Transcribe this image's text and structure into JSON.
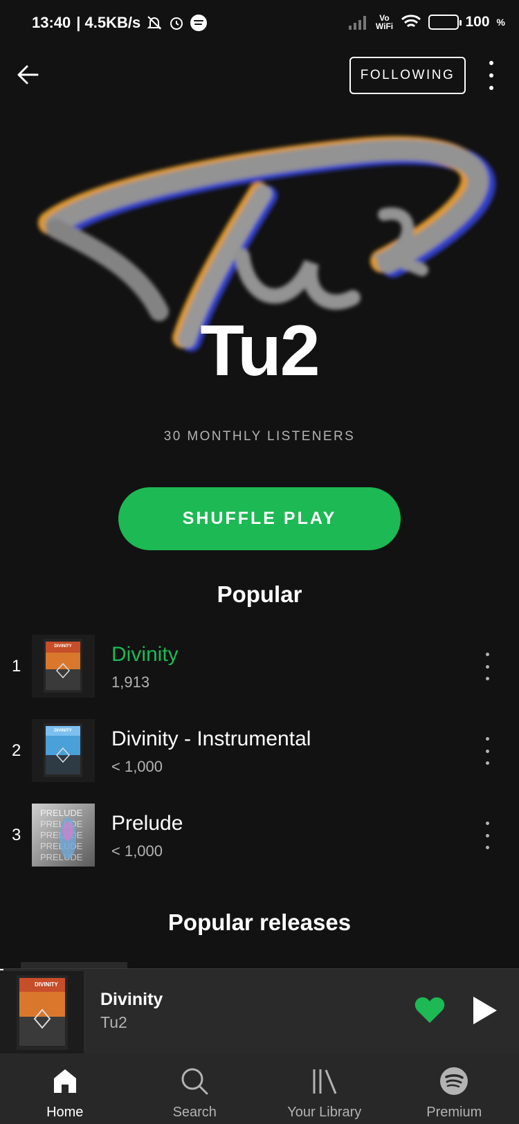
{
  "status_bar": {
    "time": "13:40",
    "speed": "| 4.5KB/s",
    "vowifi": "Vo WiFi",
    "battery": "100"
  },
  "header": {
    "follow_label": "FOLLOWING"
  },
  "artist": {
    "name": "Tu2",
    "monthly_listeners": "30 MONTHLY LISTENERS"
  },
  "shuffle_label": "SHUFFLE PLAY",
  "popular": {
    "title": "Popular",
    "tracks": [
      {
        "rank": "1",
        "title": "Divinity",
        "plays": "1,913",
        "playing": true
      },
      {
        "rank": "2",
        "title": "Divinity - Instrumental",
        "plays": "< 1,000",
        "playing": false
      },
      {
        "rank": "3",
        "title": "Prelude",
        "plays": "< 1,000",
        "playing": false
      }
    ],
    "art_labels": [
      "DIVINITY",
      "DIVINITY",
      "PRELUDE"
    ]
  },
  "releases": {
    "title": "Popular releases"
  },
  "now_playing": {
    "title": "Divinity",
    "artist": "Tu2",
    "liked": true
  },
  "tabs": [
    {
      "label": "Home",
      "icon": "home-icon",
      "active": true
    },
    {
      "label": "Search",
      "icon": "search-icon",
      "active": false
    },
    {
      "label": "Your Library",
      "icon": "library-icon",
      "active": false
    },
    {
      "label": "Premium",
      "icon": "spotify-icon",
      "active": false
    }
  ],
  "colors": {
    "accent": "#1db954",
    "background": "#121212",
    "secondary_text": "#b3b3b3",
    "bar": "#282828"
  }
}
